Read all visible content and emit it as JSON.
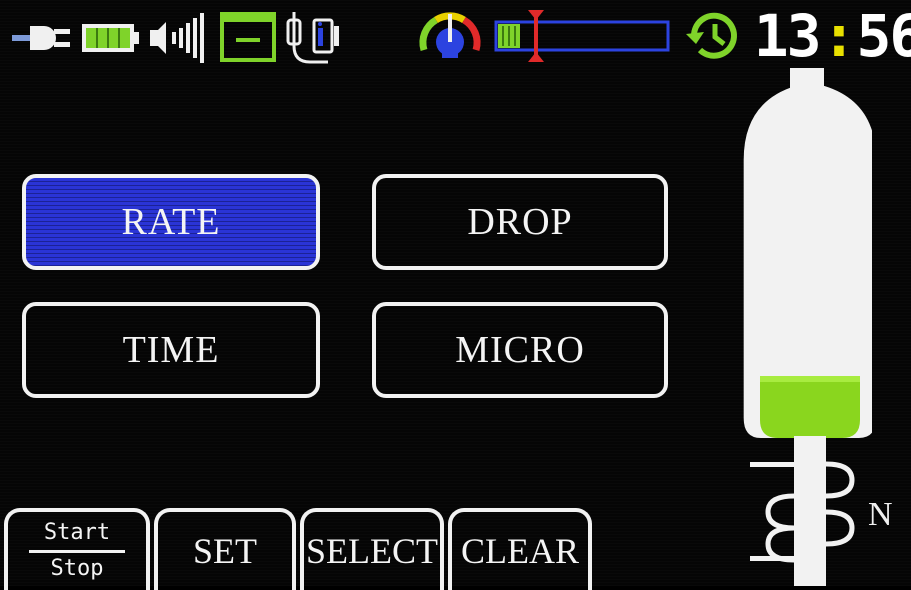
{
  "status_bar": {
    "icons": [
      "plug-icon",
      "battery-icon",
      "volume-icon",
      "box-icon",
      "sensor-icon",
      "pressure-gauge-icon",
      "occlusion-bar-icon",
      "history-clock-icon"
    ],
    "clock": {
      "hours": "13",
      "separator": ":",
      "minutes": "56"
    }
  },
  "menu": {
    "items": [
      {
        "label": "RATE",
        "active": true
      },
      {
        "label": "DROP",
        "active": false
      },
      {
        "label": "TIME",
        "active": false
      },
      {
        "label": "MICRO",
        "active": false
      }
    ]
  },
  "soft_keys": {
    "start": "Start",
    "stop": "Stop",
    "set": "SET",
    "select": "SELECT",
    "clear": "CLEAR"
  },
  "drip_panel": {
    "unit_label": "N"
  },
  "colors": {
    "active_button": "#2a34d6",
    "battery_green": "#7fd32a",
    "fluid_green": "#8ad61e",
    "accent_yellow": "#e8e000",
    "bar_blue": "#2c43e0",
    "marker_red": "#e02a2a"
  }
}
